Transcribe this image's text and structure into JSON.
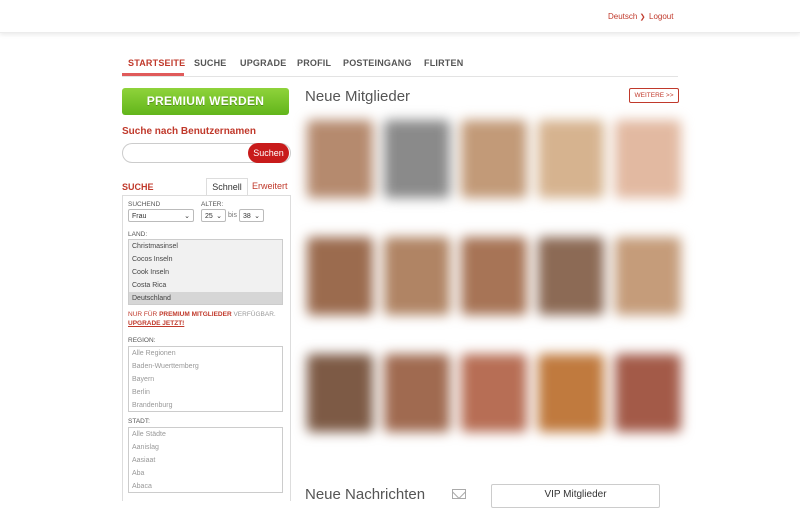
{
  "header": {
    "language": "Deutsch",
    "language_chevron": "chevron-down-icon",
    "logout": "Logout"
  },
  "nav": {
    "items": [
      "STARTSEITE",
      "SUCHE",
      "UPGRADE",
      "PROFIL",
      "POSTEINGANG",
      "FLIRTEN"
    ],
    "active_index": 0
  },
  "sidebar": {
    "premium_button": "PREMIUM WERDEN",
    "username_search_title": "Suche nach Benutzernamen",
    "username_search_placeholder": "",
    "search_button": "Suchen",
    "search_section_label": "SUCHE",
    "tab_quick": "Schnell",
    "tab_advanced": "Erweitert",
    "seeking_label": "SUCHEND",
    "seeking_value": "Frau",
    "age_label": "ALTER:",
    "age_from": "25",
    "age_to_label": "bis",
    "age_to": "38",
    "country_label": "LAND:",
    "countries": [
      "Christmasinsel",
      "Cocos Inseln",
      "Cook Inseln",
      "Costa Rica",
      "Deutschland"
    ],
    "selected_country": "Deutschland",
    "premium_note_prefix": "NUR FÜR ",
    "premium_note_bold": "PREMIUM MITGLIEDER",
    "premium_note_suffix": " VERFÜGBAR.",
    "premium_note_link": "UPGRADE JETZT!",
    "region_label": "REGION:",
    "regions": [
      "Alle Regionen",
      "Baden-Wuerttemberg",
      "Bayern",
      "Berlin",
      "Brandenburg"
    ],
    "city_label": "STADT:",
    "cities": [
      "Alle Städte",
      "Aanislag",
      "Aasiaat",
      "Aba",
      "Abaca"
    ]
  },
  "main": {
    "new_members_title": "Neue Mitglieder",
    "more_button": "WEITERE >>",
    "new_messages_title": "Neue Nachrichten",
    "messages_icon": "mail-icon",
    "vip_button": "VIP Mitglieder"
  },
  "colors": {
    "accent": "#c0392b",
    "premium_green": "#6cc12a",
    "search_red": "#c81b1b"
  }
}
